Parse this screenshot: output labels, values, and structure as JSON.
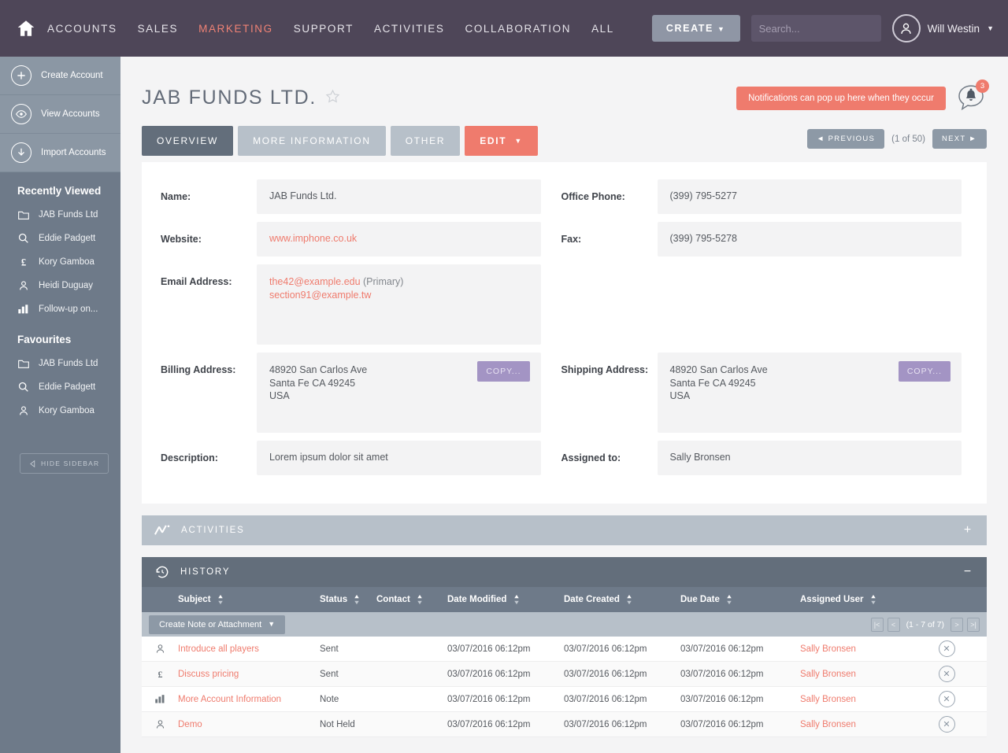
{
  "nav": {
    "home_icon": "home-icon",
    "links": [
      {
        "label": "ACCOUNTS",
        "active": false
      },
      {
        "label": "SALES",
        "active": false
      },
      {
        "label": "MARKETING",
        "active": true
      },
      {
        "label": "SUPPORT",
        "active": false
      },
      {
        "label": "ACTIVITIES",
        "active": false
      },
      {
        "label": "COLLABORATION",
        "active": false
      },
      {
        "label": "ALL",
        "active": false
      }
    ],
    "create_label": "CREATE",
    "create_caret": "▼",
    "search_placeholder": "Search...",
    "search_value": "",
    "user_name": "Will Westin",
    "user_caret": "▼"
  },
  "sidebar": {
    "actions": [
      {
        "label": "Create Account",
        "icon": "plus-circle-icon"
      },
      {
        "label": "View Accounts",
        "icon": "eye-circle-icon"
      },
      {
        "label": "Import Accounts",
        "icon": "download-circle-icon"
      }
    ],
    "recent_title": "Recently Viewed",
    "recent_items": [
      {
        "label": "JAB Funds Ltd",
        "icon": "folder-icon"
      },
      {
        "label": "Eddie Padgett",
        "icon": "search-icon"
      },
      {
        "label": "Kory Gamboa",
        "icon": "pound-icon"
      },
      {
        "label": "Heidi Duguay",
        "icon": "person-icon"
      },
      {
        "label": "Follow-up on...",
        "icon": "bar-chart-icon"
      }
    ],
    "fav_title": "Favourites",
    "fav_items": [
      {
        "label": "JAB Funds Ltd",
        "icon": "folder-icon"
      },
      {
        "label": "Eddie Padgett",
        "icon": "search-icon"
      },
      {
        "label": "Kory Gamboa",
        "icon": "person-icon"
      }
    ],
    "hide_label": "HIDE SIDEBAR"
  },
  "page": {
    "title": "JAB FUNDS LTD.",
    "favourite_icon": "star-outline-icon",
    "toast": "Notifications can pop up here when they occur",
    "notification_count": "3"
  },
  "tabs": [
    {
      "label": "OVERVIEW",
      "active": true
    },
    {
      "label": "MORE INFORMATION",
      "active": false
    },
    {
      "label": "OTHER",
      "active": false
    }
  ],
  "edit_button": {
    "label": "EDIT",
    "caret": "▼"
  },
  "record_pager": {
    "prev": "◄  PREVIOUS",
    "position": "(1 of 50)",
    "next": "NEXT  ►"
  },
  "detail": {
    "left": [
      {
        "label": "Name:",
        "value": "JAB Funds Ltd."
      },
      {
        "label": "Website:",
        "value": "www.imphone.co.uk",
        "link": true
      },
      {
        "label": "Email Address:",
        "emails": [
          {
            "address": "the42@example.edu",
            "suffix": " (Primary)"
          },
          {
            "address": "section91@example.tw",
            "suffix": ""
          }
        ]
      },
      {
        "label": "Billing Address:",
        "address": [
          "48920 San Carlos Ave",
          "Santa Fe CA 49245",
          "USA"
        ],
        "copy_label": "COPY..."
      },
      {
        "label": "Description:",
        "value": "Lorem ipsum dolor sit amet"
      }
    ],
    "right": [
      {
        "label": "Office Phone:",
        "value": "(399) 795-5277"
      },
      {
        "label": "Fax:",
        "value": "(399) 795-5278"
      },
      {
        "label": "Shipping Address:",
        "address": [
          "48920 San Carlos Ave",
          "Santa Fe CA 49245",
          "USA"
        ],
        "copy_label": "COPY..."
      },
      {
        "label": "Assigned to:",
        "value": "Sally Bronsen"
      }
    ]
  },
  "panels": {
    "activities": {
      "title": "ACTIVITIES",
      "icon": "activity-line-icon",
      "toggle": "+"
    },
    "history": {
      "title": "HISTORY",
      "icon": "history-clock-icon",
      "toggle": "−"
    }
  },
  "history_table": {
    "columns": [
      "Subject",
      "Status",
      "Contact",
      "Date Modified",
      "Date Created",
      "Due Date",
      "Assigned User"
    ],
    "create_note_label": "Create Note or Attachment",
    "create_note_caret": "▼",
    "pager_label": "(1 - 7 of 7)",
    "rows": [
      {
        "icon": "person-icon",
        "subject": "Introduce all players",
        "status": "Sent",
        "contact": "",
        "date_modified": "03/07/2016 06:12pm",
        "date_created": "03/07/2016 06:12pm",
        "due_date": "03/07/2016 06:12pm",
        "assigned_user": "Sally Bronsen"
      },
      {
        "icon": "pound-icon",
        "subject": "Discuss pricing",
        "status": "Sent",
        "contact": "",
        "date_modified": "03/07/2016 06:12pm",
        "date_created": "03/07/2016 06:12pm",
        "due_date": "03/07/2016 06:12pm",
        "assigned_user": "Sally Bronsen"
      },
      {
        "icon": "bar-chart-icon",
        "subject": "More Account Information",
        "status": "Note",
        "contact": "",
        "date_modified": "03/07/2016 06:12pm",
        "date_created": "03/07/2016 06:12pm",
        "due_date": "03/07/2016 06:12pm",
        "assigned_user": "Sally Bronsen"
      },
      {
        "icon": "person-icon",
        "subject": "Demo",
        "status": "Not Held",
        "contact": "",
        "date_modified": "03/07/2016 06:12pm",
        "date_created": "03/07/2016 06:12pm",
        "due_date": "03/07/2016 06:12pm",
        "assigned_user": "Sally Bronsen"
      }
    ]
  },
  "colors": {
    "header_bg": "#4e4658",
    "accent_coral": "#ef7b6d",
    "sidebar_bg": "#6e7a89",
    "sidebar_action_bg": "#8b97a4",
    "panel_dark": "#636e7b",
    "panel_light": "#b7c0c9",
    "copy_purple": "#a394c4"
  }
}
